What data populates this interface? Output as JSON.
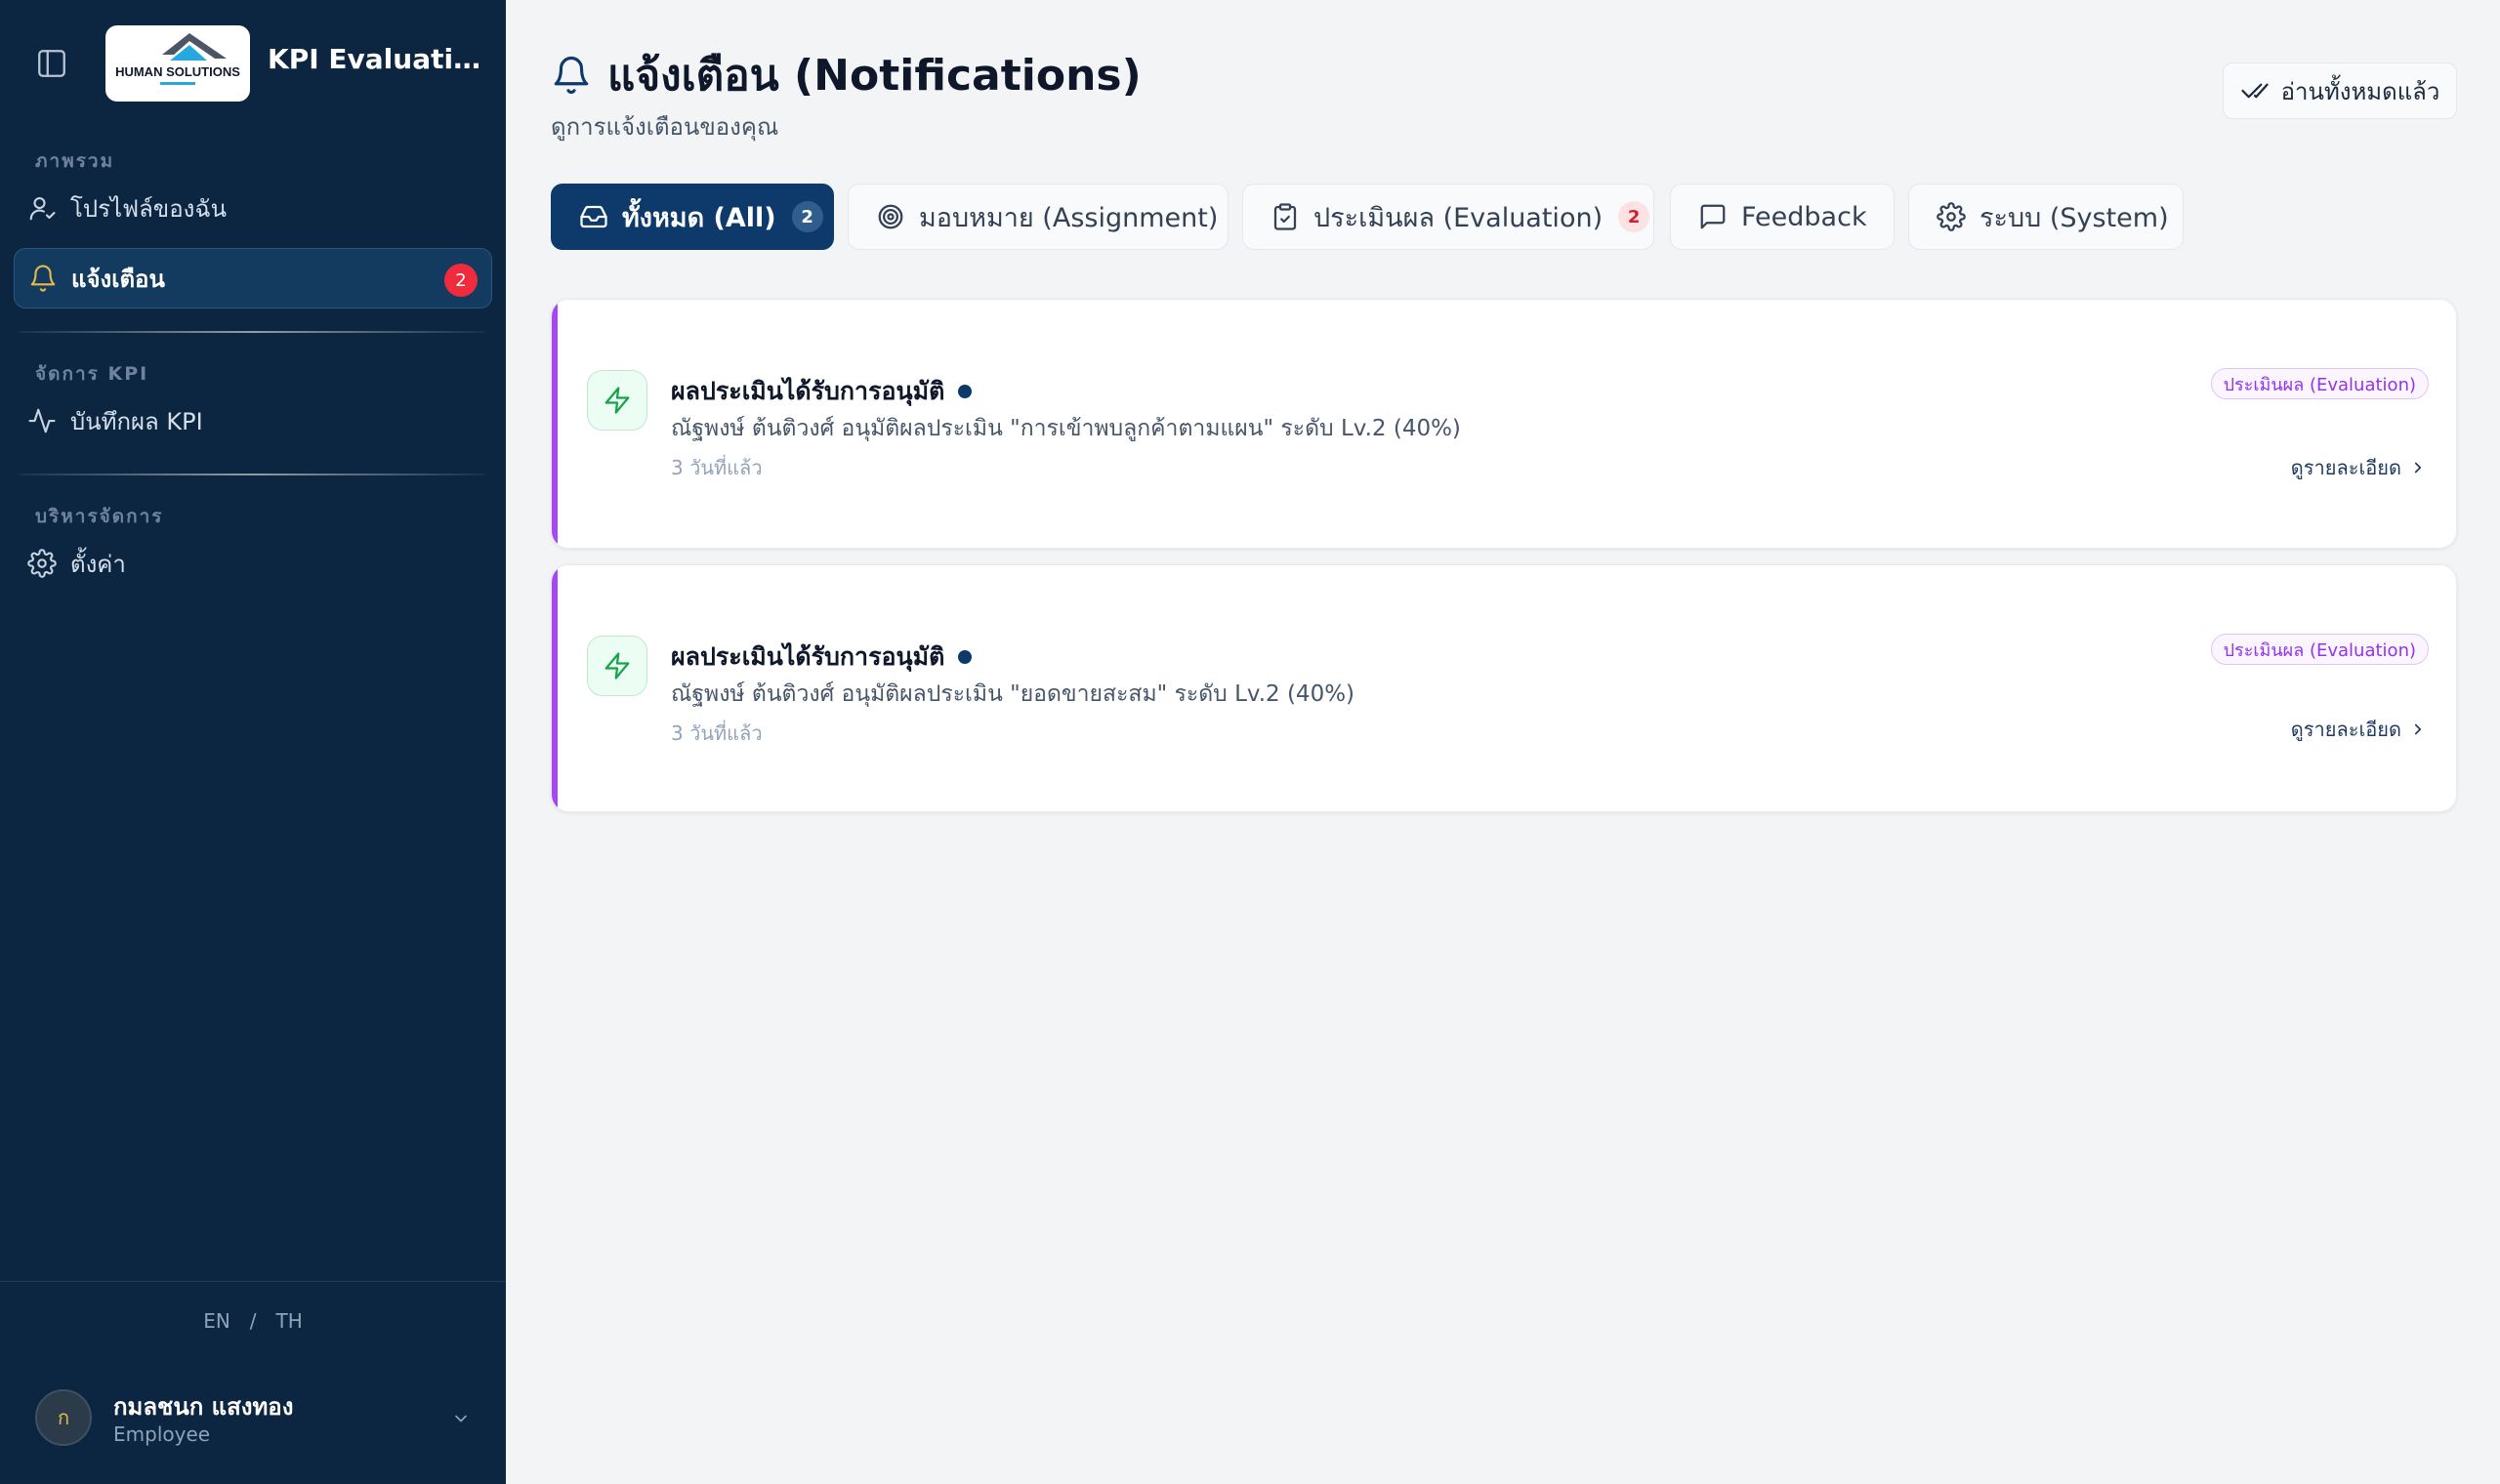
{
  "sidebar": {
    "app_title": "KPI Evaluation ...",
    "logo_text": "HUMAN SOLUTIONS",
    "sections": [
      {
        "label": "ภาพรวม",
        "items": [
          {
            "label": "โปรไฟล์ของฉัน",
            "icon": "user-icon"
          },
          {
            "label": "แจ้งเตือน",
            "icon": "bell-icon",
            "badge": "2",
            "active": true
          }
        ]
      },
      {
        "label": "จัดการ KPI",
        "items": [
          {
            "label": "บันทึกผล KPI",
            "icon": "activity-icon"
          }
        ]
      },
      {
        "label": "บริหารจัดการ",
        "items": [
          {
            "label": "ตั้งค่า",
            "icon": "gear-icon"
          }
        ]
      }
    ],
    "lang": {
      "en": "EN",
      "sep": "/",
      "th": "TH"
    },
    "user": {
      "initial": "ก",
      "name": "กมลชนก แสงทอง",
      "role": "Employee"
    }
  },
  "header": {
    "title": "แจ้งเตือน (Notifications)",
    "subtitle": "ดูการแจ้งเตือนของคุณ",
    "read_all_label": "อ่านทั้งหมดแล้ว"
  },
  "tabs": [
    {
      "label": "ทั้งหมด (All)",
      "count": "2",
      "active": true,
      "icon": "inbox-icon"
    },
    {
      "label": "มอบหมาย (Assignment)",
      "icon": "target-icon"
    },
    {
      "label": "ประเมินผล (Evaluation)",
      "count": "2",
      "icon": "clipboard-check-icon"
    },
    {
      "label": "Feedback",
      "icon": "message-icon"
    },
    {
      "label": "ระบบ (System)",
      "icon": "gear-icon"
    }
  ],
  "notifications": [
    {
      "title": "ผลประเมินได้รับการอนุมัติ",
      "message": "ณัฐพงษ์ ต้นติวงศ์ อนุมัติผลประเมิน \"การเข้าพบลูกค้าตามแผน\" ระดับ Lv.2 (40%)",
      "time": "3 วันที่แล้ว",
      "tag": "ประเมินผล (Evaluation)",
      "detail_label": "ดูรายละเอียด",
      "unread": true
    },
    {
      "title": "ผลประเมินได้รับการอนุมัติ",
      "message": "ณัฐพงษ์ ต้นติวงศ์ อนุมัติผลประเมิน \"ยอดขายสะสม\" ระดับ Lv.2 (40%)",
      "time": "3 วันที่แล้ว",
      "tag": "ประเมินผล (Evaluation)",
      "detail_label": "ดูรายละเอียด",
      "unread": true
    }
  ],
  "colors": {
    "sidebar_bg": "#0c2540",
    "primary": "#0d3a6b",
    "badge_red": "#ef2b3e",
    "evaluation_accent": "#a646f5",
    "page_bg": "#f3f4f6"
  }
}
